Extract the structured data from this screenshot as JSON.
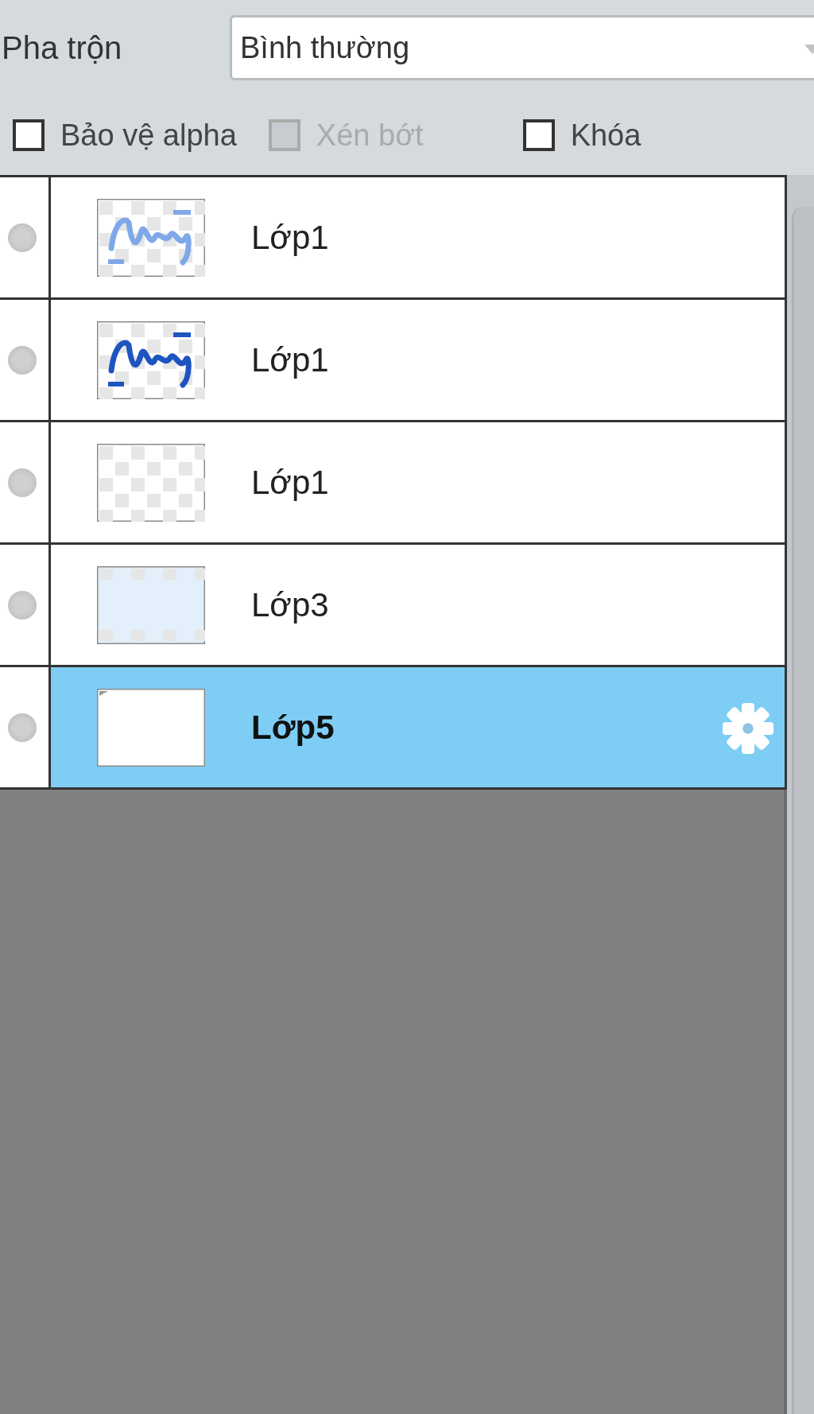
{
  "blend": {
    "label": "Pha trộn",
    "value": "Bình thường"
  },
  "options": [
    {
      "label": "Bảo vệ alpha",
      "checked": false,
      "disabled": false
    },
    {
      "label": "Xén bớt",
      "checked": false,
      "disabled": true
    },
    {
      "label": "Khóa",
      "checked": false,
      "disabled": false
    }
  ],
  "layers": [
    {
      "name": "Lớp1",
      "kind": "faint-script",
      "selected": false
    },
    {
      "name": "Lớp1",
      "kind": "script",
      "selected": false
    },
    {
      "name": "Lớp1",
      "kind": "empty",
      "selected": false
    },
    {
      "name": "Lớp3",
      "kind": "tint",
      "selected": false
    },
    {
      "name": "Lớp5",
      "kind": "blank",
      "selected": true
    }
  ]
}
